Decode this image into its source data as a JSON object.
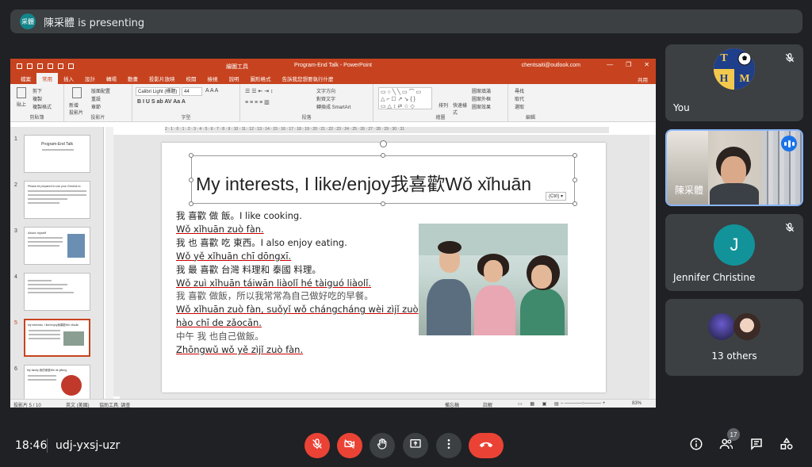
{
  "presenting": {
    "avatar_text": "采體",
    "text": "陳采體 is presenting"
  },
  "ppt": {
    "window_title": "Program-End Talk  -  PowerPoint",
    "tool_context": "繪圖工具",
    "account": "chentsaiti@outlook.com",
    "tabs": [
      "檔案",
      "常用",
      "插入",
      "設計",
      "轉場",
      "動畫",
      "投影片放映",
      "校閱",
      "檢視",
      "說明",
      "圖形格式",
      "告訴我您想要執行什麼"
    ],
    "share_label": "共用",
    "ribbon": {
      "paste": "貼上",
      "cut": "剪下",
      "copy": "複製",
      "format_painter": "複製格式",
      "clipboard": "剪貼簿",
      "new_slide": "新增\n投影片",
      "layout": "版面配置",
      "reset": "重設",
      "section": "章節",
      "slides": "投影片",
      "font_name": "Calibri Light (標題)",
      "font_size": "44",
      "font_group": "字型",
      "text_direction": "文字方向",
      "align_text": "對齊文字",
      "smartart": "轉換成 SmartArt",
      "paragraph": "段落",
      "arrange": "排列",
      "quick_styles": "快速樣\n式",
      "shape_fill": "圖案填滿",
      "shape_outline": "圖案外框",
      "shape_effects": "圖案效果",
      "drawing": "繪圖",
      "find": "尋找",
      "replace": "取代",
      "select": "選取",
      "editing": "編輯"
    },
    "ruler_text": "2 · 1 · 0 · 1 · 2 · 3 · 4 · 5 · 6 · 7 · 8 · 9 · 10 · 11 · 12 · 13 · 14 · 15 · 16 · 17 · 18 · 19 · 20 · 21 · 22 · 23 · 24 · 25 · 26 · 27 · 28 · 29 · 30 · 31",
    "thumbs": [
      {
        "num": "1",
        "title": "Program-End Talk"
      },
      {
        "num": "2",
        "title": "Please be prepared to use your Chinese to"
      },
      {
        "num": "3",
        "title": "About myself"
      },
      {
        "num": "4",
        "title": ""
      },
      {
        "num": "5",
        "title": "My interests, I like/enjoy我喜歡Wǒ xǐhuān"
      },
      {
        "num": "6",
        "title": "My family 我的家庭Wǒ de jiātíng"
      }
    ],
    "status": {
      "slide_count": "投影片 5 / 10",
      "language": "英文 (美國)",
      "accessibility": "協助工具: 調查",
      "notes": "備忘稿",
      "comments": "註解",
      "zoom": "83%"
    }
  },
  "slide": {
    "title": "My interests, I like/enjoy我喜歡Wǒ xǐhuān",
    "ctrl_tag": "(Ctrl) ▾",
    "lines": [
      {
        "text": "我  喜歡  做  飯。I like cooking.",
        "style": "normal"
      },
      {
        "text": "Wǒ xǐhuān zuò fàn.",
        "style": "py"
      },
      {
        "text": "我  也  喜歡  吃 東西。I also enjoy eating.",
        "style": "normal"
      },
      {
        "text": "Wǒ yě xǐhuān chī dōngxī.",
        "style": "py"
      },
      {
        "text": "我  最  喜歡  台灣 料理和 泰國 料理。",
        "style": "normal"
      },
      {
        "text": "Wǒ zuì xǐhuān táiwān liàolǐ hé tàiguó liàolǐ.",
        "style": "py"
      },
      {
        "text": "我  喜歡 做飯，所以我常常為自己做好吃的早餐。",
        "style": "gray"
      },
      {
        "text": "Wǒ xǐhuān zuò fàn, suǒyǐ wǒ chángcháng wèi zìjǐ zuò",
        "style": "py"
      },
      {
        "text": "hào chī de zǎocān.",
        "style": "py"
      },
      {
        "text": "中午      我 也自己做飯。",
        "style": "gray"
      },
      {
        "text": "Zhōngwǔ wǒ yě zìjǐ zuò fàn.",
        "style": "py"
      }
    ]
  },
  "participants": {
    "you": {
      "name": "You",
      "logo": [
        "T",
        "",
        "H",
        "M"
      ]
    },
    "speaker": {
      "name": "陳采體"
    },
    "jennifer": {
      "initial": "J",
      "name": "Jennifer Christine"
    },
    "others": {
      "label": "13 others"
    }
  },
  "bottom": {
    "time": "18:46",
    "meeting_code": "udj-yxsj-uzr",
    "people_count": "17"
  },
  "icons": [
    "mic-off-icon",
    "camera-off-icon",
    "raise-hand-icon",
    "present-icon",
    "more-options-icon",
    "end-call-icon",
    "info-icon",
    "people-icon",
    "chat-icon",
    "activities-icon"
  ],
  "colors": {
    "ppt_accent": "#c7431f",
    "danger": "#ea4335",
    "speaker_border": "#8ab4f8",
    "meet_bg": "#202124"
  }
}
